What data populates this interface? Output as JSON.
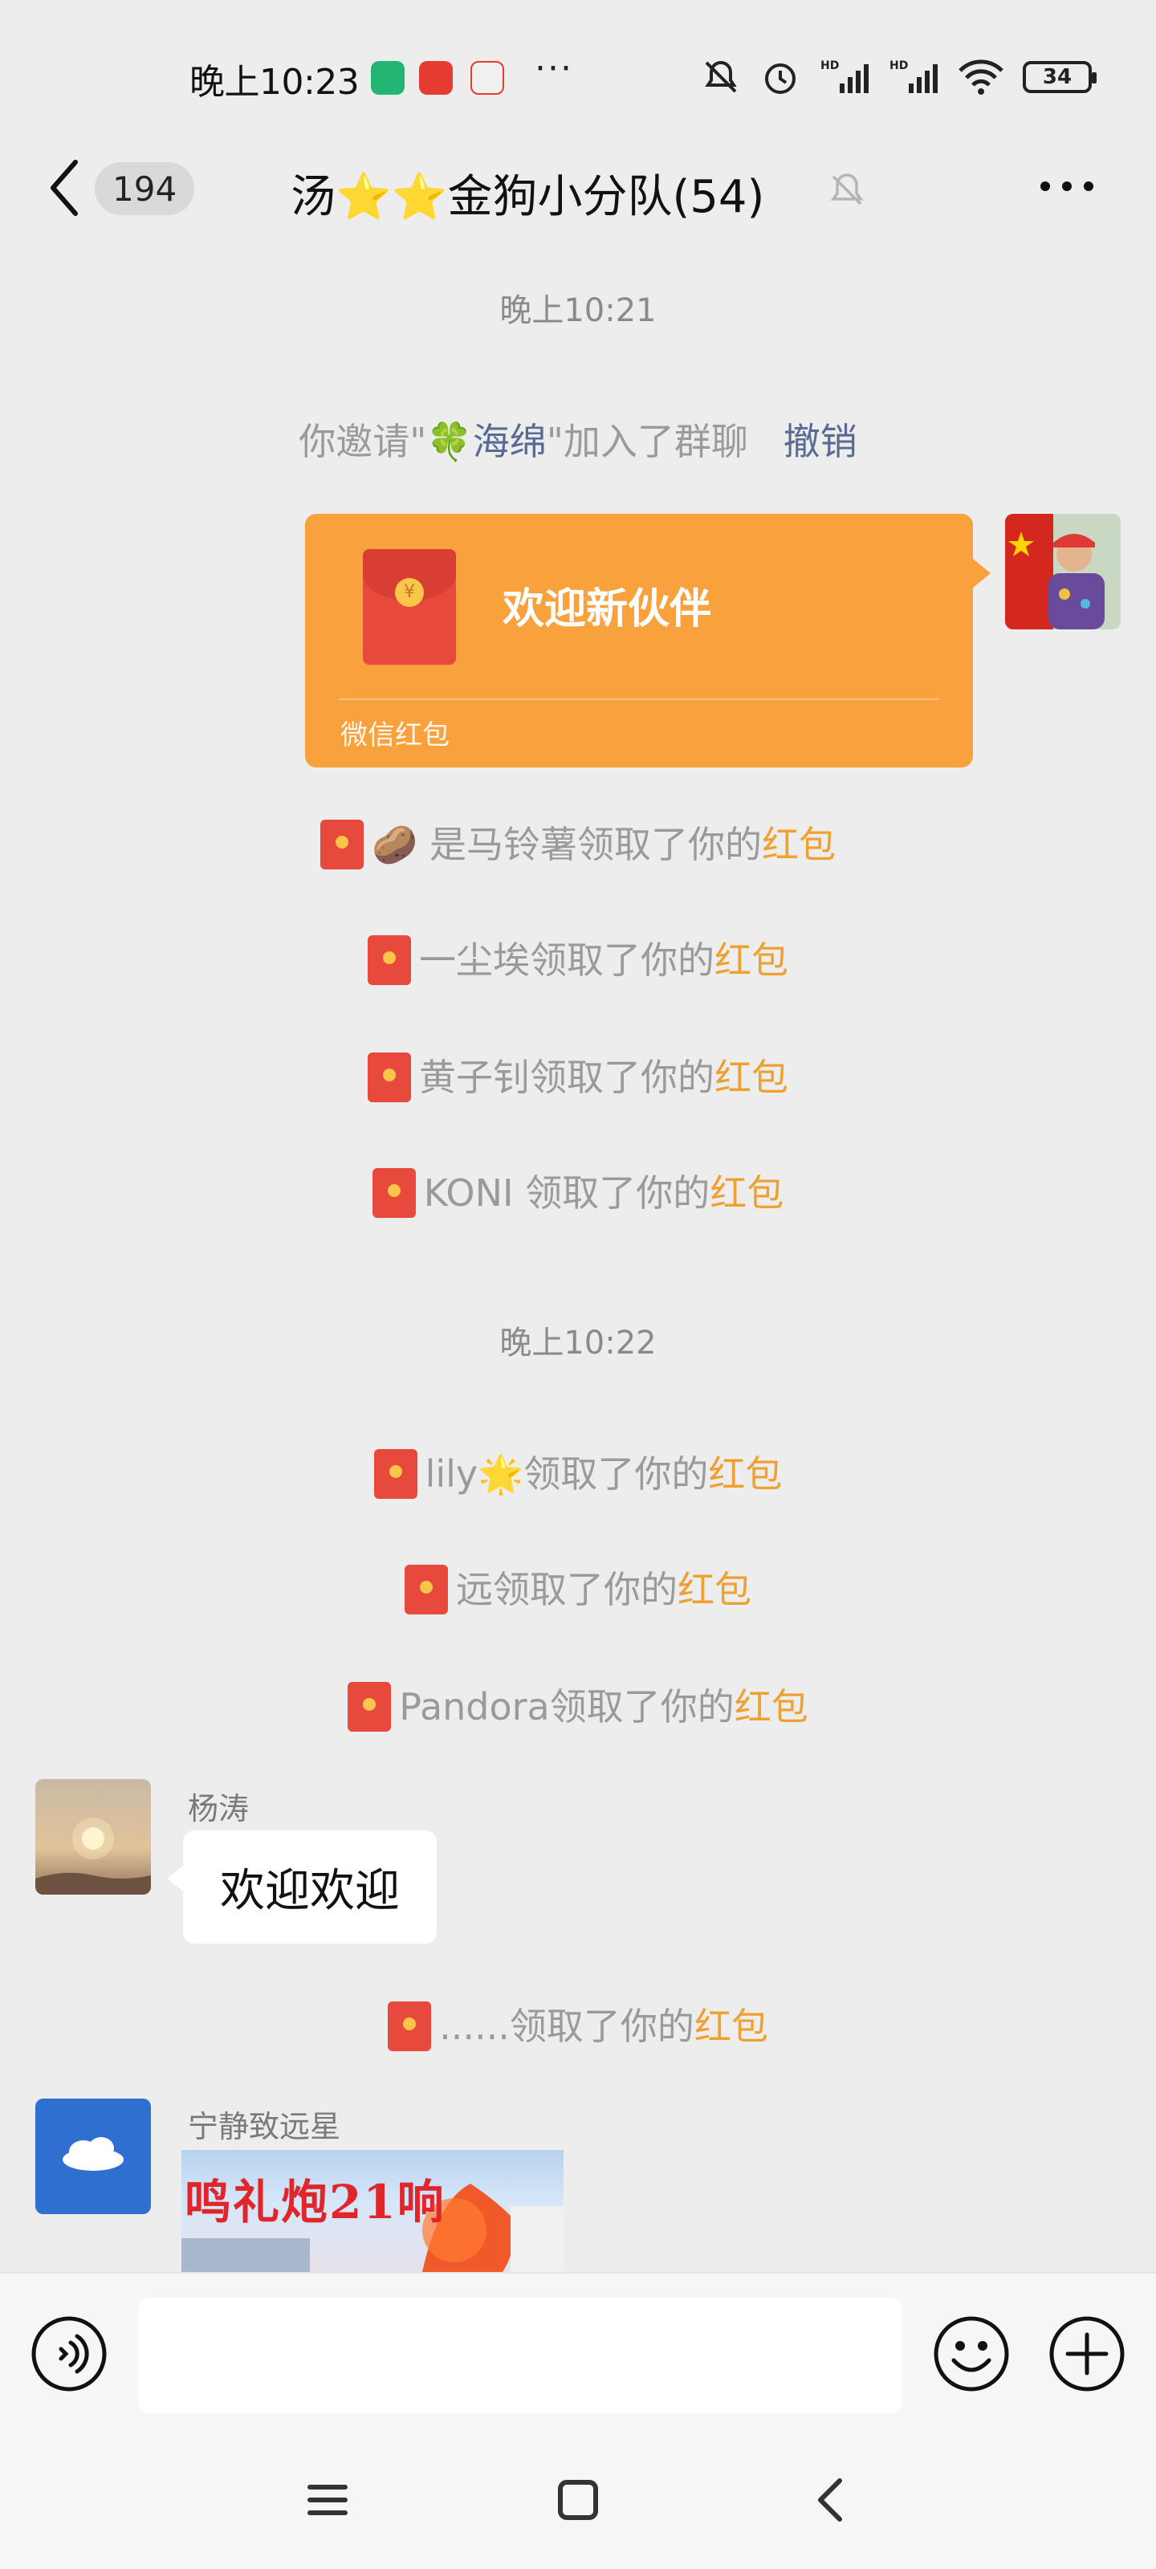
{
  "status_bar": {
    "time": "晚上10:23",
    "dots": "···",
    "battery": "34"
  },
  "header": {
    "unread_count": "194",
    "title": "汤⭐⭐金狗小分队(54)"
  },
  "messages": {
    "time1": "晚上10:21",
    "invite_prefix": "你邀请\"",
    "invite_emoji": "🍀",
    "invite_name": "海绵",
    "invite_suffix": "\"加入了群聊",
    "revoke": "撤销",
    "red_packet_text": "欢迎新伙伴",
    "red_packet_footer": "微信红包",
    "red_packet_symbol": "¥",
    "claim_suffix": "领取了你的",
    "claim_link": "红包",
    "claims_group1": [
      {
        "name": "🥔 是马铃薯"
      },
      {
        "name": "一尘埃"
      },
      {
        "name": "黄子钊"
      },
      {
        "name": "KONI "
      }
    ],
    "time2": "晚上10:22",
    "claims_group2": [
      {
        "name": "lily🌟"
      },
      {
        "name": "远"
      },
      {
        "name": "Pandora"
      }
    ],
    "sender1_name": "杨涛",
    "sender1_text": "欢迎欢迎",
    "claim_after": {
      "name": "......"
    },
    "sender2_name": "宁静致远星",
    "sticker_caption": "鸣礼炮21响"
  },
  "input_bar": {
    "placeholder": ""
  }
}
